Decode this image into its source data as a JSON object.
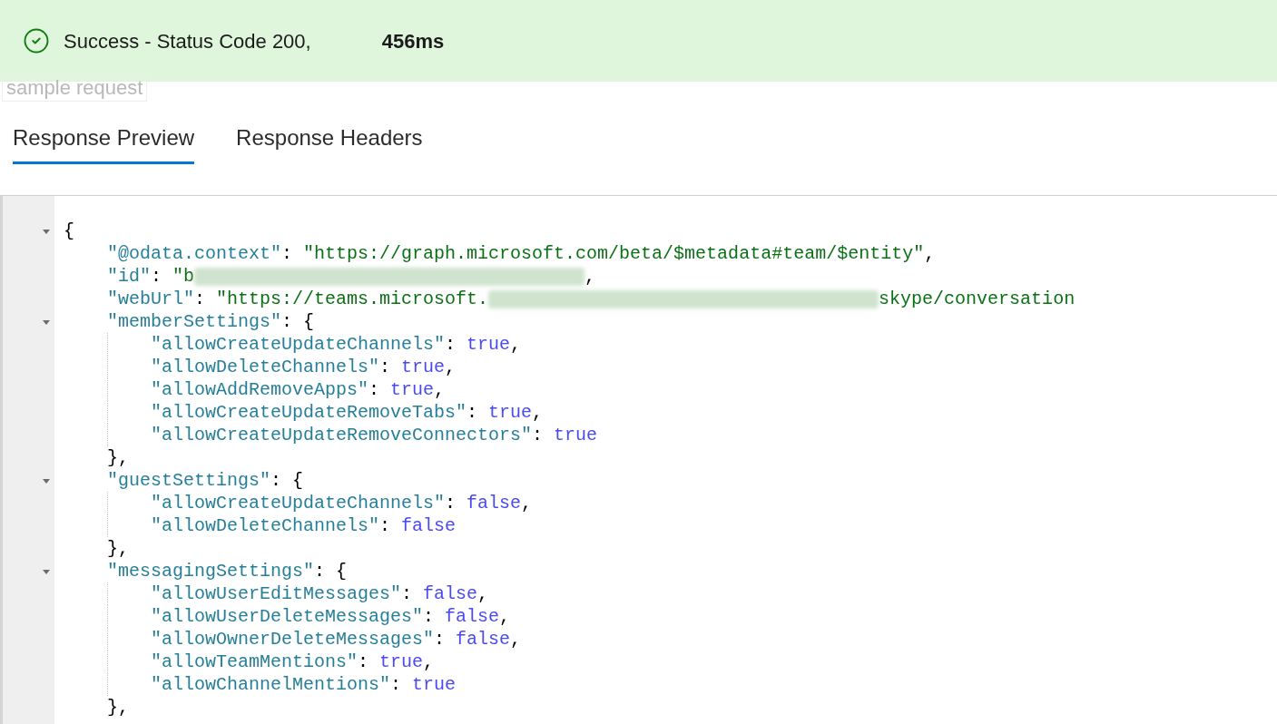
{
  "status": {
    "message": "Success - Status Code 200,",
    "duration": "456ms"
  },
  "ghost_label": "sample request",
  "tabs": [
    {
      "label": "Response Preview",
      "selected": true
    },
    {
      "label": "Response Headers",
      "selected": false
    }
  ],
  "response": {
    "expanded": true,
    "tokens": [
      {
        "kind": "punct",
        "text": "{"
      }
    ],
    "children": [
      {
        "tokens": [
          {
            "kind": "key",
            "text": "\"@odata.context\""
          },
          {
            "kind": "punct",
            "text": ":"
          },
          {
            "kind": "string",
            "text": "\"https://graph.microsoft.com/beta/$metadata#team/$entity\""
          },
          {
            "kind": "punct",
            "text": ","
          }
        ]
      },
      {
        "tokens": [
          {
            "kind": "key",
            "text": "\"id\""
          },
          {
            "kind": "punct",
            "text": ":"
          },
          {
            "kind": "string",
            "text": "\"b"
          },
          {
            "kind": "redacted"
          },
          {
            "kind": "punct",
            "text": ","
          }
        ]
      },
      {
        "tokens": [
          {
            "kind": "key",
            "text": "\"webUrl\""
          },
          {
            "kind": "punct",
            "text": ":"
          },
          {
            "kind": "string",
            "text": "\"https://teams.microsoft."
          },
          {
            "kind": "redacted"
          },
          {
            "kind": "string",
            "text": "skype/conversation"
          }
        ]
      },
      {
        "expanded": true,
        "tokens": [
          {
            "kind": "key",
            "text": "\"memberSettings\""
          },
          {
            "kind": "punct",
            "text": ":"
          },
          {
            "kind": "punct",
            "text": "{"
          }
        ],
        "close": "},",
        "children": [
          {
            "tokens": [
              {
                "kind": "key",
                "text": "\"allowCreateUpdateChannels\""
              },
              {
                "kind": "punct",
                "text": ":"
              },
              {
                "kind": "boolean",
                "text": "true"
              },
              {
                "kind": "punct",
                "text": ","
              }
            ]
          },
          {
            "tokens": [
              {
                "kind": "key",
                "text": "\"allowDeleteChannels\""
              },
              {
                "kind": "punct",
                "text": ":"
              },
              {
                "kind": "boolean",
                "text": "true"
              },
              {
                "kind": "punct",
                "text": ","
              }
            ]
          },
          {
            "tokens": [
              {
                "kind": "key",
                "text": "\"allowAddRemoveApps\""
              },
              {
                "kind": "punct",
                "text": ":"
              },
              {
                "kind": "boolean",
                "text": "true"
              },
              {
                "kind": "punct",
                "text": ","
              }
            ]
          },
          {
            "tokens": [
              {
                "kind": "key",
                "text": "\"allowCreateUpdateRemoveTabs\""
              },
              {
                "kind": "punct",
                "text": ":"
              },
              {
                "kind": "boolean",
                "text": "true"
              },
              {
                "kind": "punct",
                "text": ","
              }
            ]
          },
          {
            "tokens": [
              {
                "kind": "key",
                "text": "\"allowCreateUpdateRemoveConnectors\""
              },
              {
                "kind": "punct",
                "text": ":"
              },
              {
                "kind": "boolean",
                "text": "true"
              }
            ]
          }
        ]
      },
      {
        "expanded": true,
        "tokens": [
          {
            "kind": "key",
            "text": "\"guestSettings\""
          },
          {
            "kind": "punct",
            "text": ":"
          },
          {
            "kind": "punct",
            "text": "{"
          }
        ],
        "close": "},",
        "children": [
          {
            "tokens": [
              {
                "kind": "key",
                "text": "\"allowCreateUpdateChannels\""
              },
              {
                "kind": "punct",
                "text": ":"
              },
              {
                "kind": "boolean",
                "text": "false"
              },
              {
                "kind": "punct",
                "text": ","
              }
            ]
          },
          {
            "tokens": [
              {
                "kind": "key",
                "text": "\"allowDeleteChannels\""
              },
              {
                "kind": "punct",
                "text": ":"
              },
              {
                "kind": "boolean",
                "text": "false"
              }
            ]
          }
        ]
      },
      {
        "expanded": true,
        "tokens": [
          {
            "kind": "key",
            "text": "\"messagingSettings\""
          },
          {
            "kind": "punct",
            "text": ":"
          },
          {
            "kind": "punct",
            "text": "{"
          }
        ],
        "close": "},",
        "children": [
          {
            "tokens": [
              {
                "kind": "key",
                "text": "\"allowUserEditMessages\""
              },
              {
                "kind": "punct",
                "text": ":"
              },
              {
                "kind": "boolean",
                "text": "false"
              },
              {
                "kind": "punct",
                "text": ","
              }
            ]
          },
          {
            "tokens": [
              {
                "kind": "key",
                "text": "\"allowUserDeleteMessages\""
              },
              {
                "kind": "punct",
                "text": ":"
              },
              {
                "kind": "boolean",
                "text": "false"
              },
              {
                "kind": "punct",
                "text": ","
              }
            ]
          },
          {
            "tokens": [
              {
                "kind": "key",
                "text": "\"allowOwnerDeleteMessages\""
              },
              {
                "kind": "punct",
                "text": ":"
              },
              {
                "kind": "boolean",
                "text": "false"
              },
              {
                "kind": "punct",
                "text": ","
              }
            ]
          },
          {
            "tokens": [
              {
                "kind": "key",
                "text": "\"allowTeamMentions\""
              },
              {
                "kind": "punct",
                "text": ":"
              },
              {
                "kind": "boolean",
                "text": "true"
              },
              {
                "kind": "punct",
                "text": ","
              }
            ]
          },
          {
            "tokens": [
              {
                "kind": "key",
                "text": "\"allowChannelMentions\""
              },
              {
                "kind": "punct",
                "text": ":"
              },
              {
                "kind": "boolean",
                "text": "true"
              }
            ]
          }
        ]
      }
    ]
  }
}
